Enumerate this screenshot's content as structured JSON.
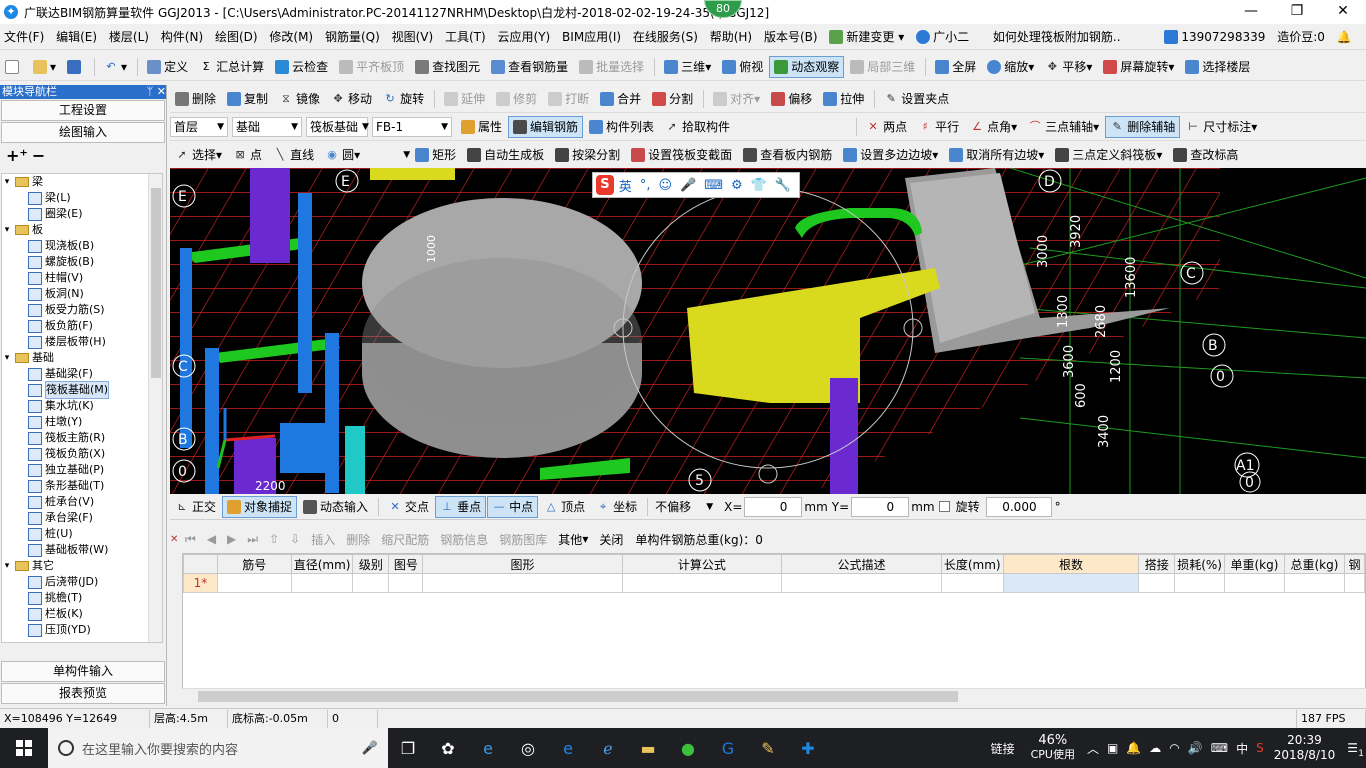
{
  "titlebar": {
    "title": "广联达BIM钢筋算量软件 GGJ2013 - [C:\\Users\\Administrator.PC-20141127NRHM\\Desktop\\白龙村-2018-02-02-19-24-35(    ).GGJ12]",
    "badge": "80",
    "minimize": "—",
    "restore": "❐",
    "close": "✕"
  },
  "menubar": {
    "items": [
      "文件(F)",
      "编辑(E)",
      "楼层(L)",
      "构件(N)",
      "绘图(D)",
      "修改(M)",
      "钢筋量(Q)",
      "视图(V)",
      "工具(T)",
      "云应用(Y)",
      "BIM应用(I)",
      "在线服务(S)",
      "帮助(H)",
      "版本号(B)"
    ],
    "new_change": "新建变更",
    "assistant": "广小二",
    "question": "如何处理筏板附加钢筋..",
    "phone": "13907298339",
    "price": "造价豆:0"
  },
  "toolbar1": {
    "items": [
      "定义",
      "汇总计算",
      "云检查",
      "平齐板顶",
      "查找图元",
      "查看钢筋量",
      "批量选择",
      "三维",
      "俯视",
      "动态观察",
      "局部三维",
      "全屏",
      "缩放",
      "平移",
      "屏幕旋转",
      "选择楼层"
    ]
  },
  "toolbar2": {
    "items": [
      "删除",
      "复制",
      "镜像",
      "移动",
      "旋转",
      "延伸",
      "修剪",
      "打断",
      "合并",
      "分割",
      "对齐",
      "偏移",
      "拉伸",
      "设置夹点"
    ]
  },
  "toolbar3": {
    "floor": "首层",
    "category": "基础",
    "type": "筏板基础",
    "element": "FB-1",
    "items": [
      "属性",
      "编辑钢筋",
      "构件列表",
      "拾取构件",
      "两点",
      "平行",
      "点角",
      "三点辅轴",
      "删除辅轴",
      "尺寸标注"
    ]
  },
  "toolbar4": {
    "items": [
      "选择",
      "点",
      "直线",
      "圆",
      "矩形",
      "自动生成板",
      "按梁分割",
      "设置筏板变截面",
      "查看板内钢筋",
      "设置多边边坡",
      "取消所有边坡",
      "三点定义斜筏板",
      "查改标高"
    ]
  },
  "leftpanel": {
    "header": "模块导航栏",
    "pin": "ᛘ ✕",
    "project_settings": "工程设置",
    "drawing_input": "绘图输入",
    "single_input": "单构件输入",
    "report_preview": "报表预览",
    "tree": [
      {
        "level": 0,
        "label": "梁",
        "expanded": true
      },
      {
        "level": 1,
        "label": "梁(L)"
      },
      {
        "level": 1,
        "label": "圈梁(E)"
      },
      {
        "level": 0,
        "label": "板",
        "expanded": true
      },
      {
        "level": 1,
        "label": "现浇板(B)"
      },
      {
        "level": 1,
        "label": "螺旋板(B)"
      },
      {
        "level": 1,
        "label": "柱帽(V)"
      },
      {
        "level": 1,
        "label": "板洞(N)"
      },
      {
        "level": 1,
        "label": "板受力筋(S)"
      },
      {
        "level": 1,
        "label": "板负筋(F)"
      },
      {
        "level": 1,
        "label": "楼层板带(H)"
      },
      {
        "level": 0,
        "label": "基础",
        "expanded": true
      },
      {
        "level": 1,
        "label": "基础梁(F)"
      },
      {
        "level": 1,
        "label": "筏板基础(M)",
        "selected": true
      },
      {
        "level": 1,
        "label": "集水坑(K)"
      },
      {
        "level": 1,
        "label": "柱墩(Y)"
      },
      {
        "level": 1,
        "label": "筏板主筋(R)"
      },
      {
        "level": 1,
        "label": "筏板负筋(X)"
      },
      {
        "level": 1,
        "label": "独立基础(P)"
      },
      {
        "level": 1,
        "label": "条形基础(T)"
      },
      {
        "level": 1,
        "label": "桩承台(V)"
      },
      {
        "level": 1,
        "label": "承台梁(F)"
      },
      {
        "level": 1,
        "label": "桩(U)"
      },
      {
        "level": 1,
        "label": "基础板带(W)"
      },
      {
        "level": 0,
        "label": "其它",
        "expanded": true
      },
      {
        "level": 1,
        "label": "后浇带(JD)"
      },
      {
        "level": 1,
        "label": "挑檐(T)"
      },
      {
        "level": 1,
        "label": "栏板(K)"
      },
      {
        "level": 1,
        "label": "压顶(YD)"
      }
    ]
  },
  "viewport": {
    "axis_labels": [
      "E",
      "D",
      "C",
      "B",
      "0",
      "A1",
      "5",
      "0",
      "E",
      "C",
      "B",
      "0"
    ],
    "dims": [
      "3920",
      "13600",
      "3000",
      "2680",
      "1200",
      "3400",
      "1000",
      "2200",
      "3600",
      "1300",
      "600"
    ]
  },
  "ime": {
    "mode": "英"
  },
  "snapbar": {
    "items": [
      "正交",
      "对象捕捉",
      "动态输入",
      "交点",
      "垂点",
      "中点",
      "顶点",
      "坐标"
    ],
    "offset": "不偏移",
    "x_label": "X=",
    "x_value": "0",
    "y_label": "Y=",
    "y_value": "0",
    "unit": "mm",
    "rotate": "旋转",
    "rotate_value": "0.000",
    "degree": "°"
  },
  "gridtool": {
    "items": [
      "插入",
      "删除",
      "缩尺配筋",
      "钢筋信息",
      "钢筋图库",
      "其他",
      "关闭"
    ],
    "total": "单构件钢筋总重(kg)：0"
  },
  "grid": {
    "columns": [
      "",
      "筋号",
      "直径(mm)",
      "级别",
      "图号",
      "图形",
      "计算公式",
      "公式描述",
      "长度(mm)",
      "根数",
      "搭接",
      "损耗(%)",
      "单重(kg)",
      "总重(kg)",
      "钢"
    ],
    "row1": "1*"
  },
  "statusbar": {
    "coords": "X=108496 Y=12649",
    "floor_height": "层高:4.5m",
    "base_elev": "底标高:-0.05m",
    "value": "0",
    "fps": "187 FPS"
  },
  "taskbar": {
    "search_placeholder": "在这里输入你要搜索的内容",
    "link": "链接",
    "cpu": "46%",
    "cpu_label": "CPU使用",
    "ime": "中",
    "time": "20:39",
    "date": "2018/8/10",
    "notif": "1"
  }
}
